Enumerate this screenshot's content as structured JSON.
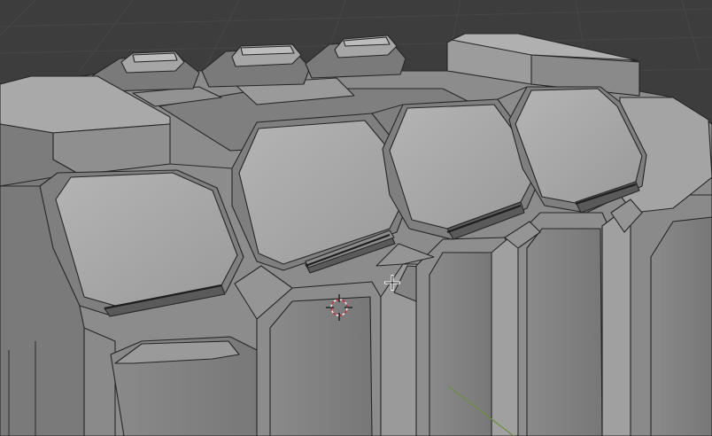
{
  "viewport": {
    "type": "3d-viewport",
    "background_color": "#3d3d3d",
    "grid_color": "#474747",
    "shading": "solid",
    "axis_line_color": "#6b8f3a"
  },
  "scene": {
    "object": "segmented-armor-mesh",
    "plates_visible": 5,
    "buttons_visible": 3,
    "pillars_visible": 6
  },
  "cursor": {
    "icon": "move-crosshair-icon"
  },
  "gizmo": {
    "icon": "3d-cursor-icon"
  },
  "colors": {
    "face_light": "#a8a8a8",
    "face_mid": "#8e8e8e",
    "face_dark": "#6e6e6e",
    "edge": "#262626"
  }
}
